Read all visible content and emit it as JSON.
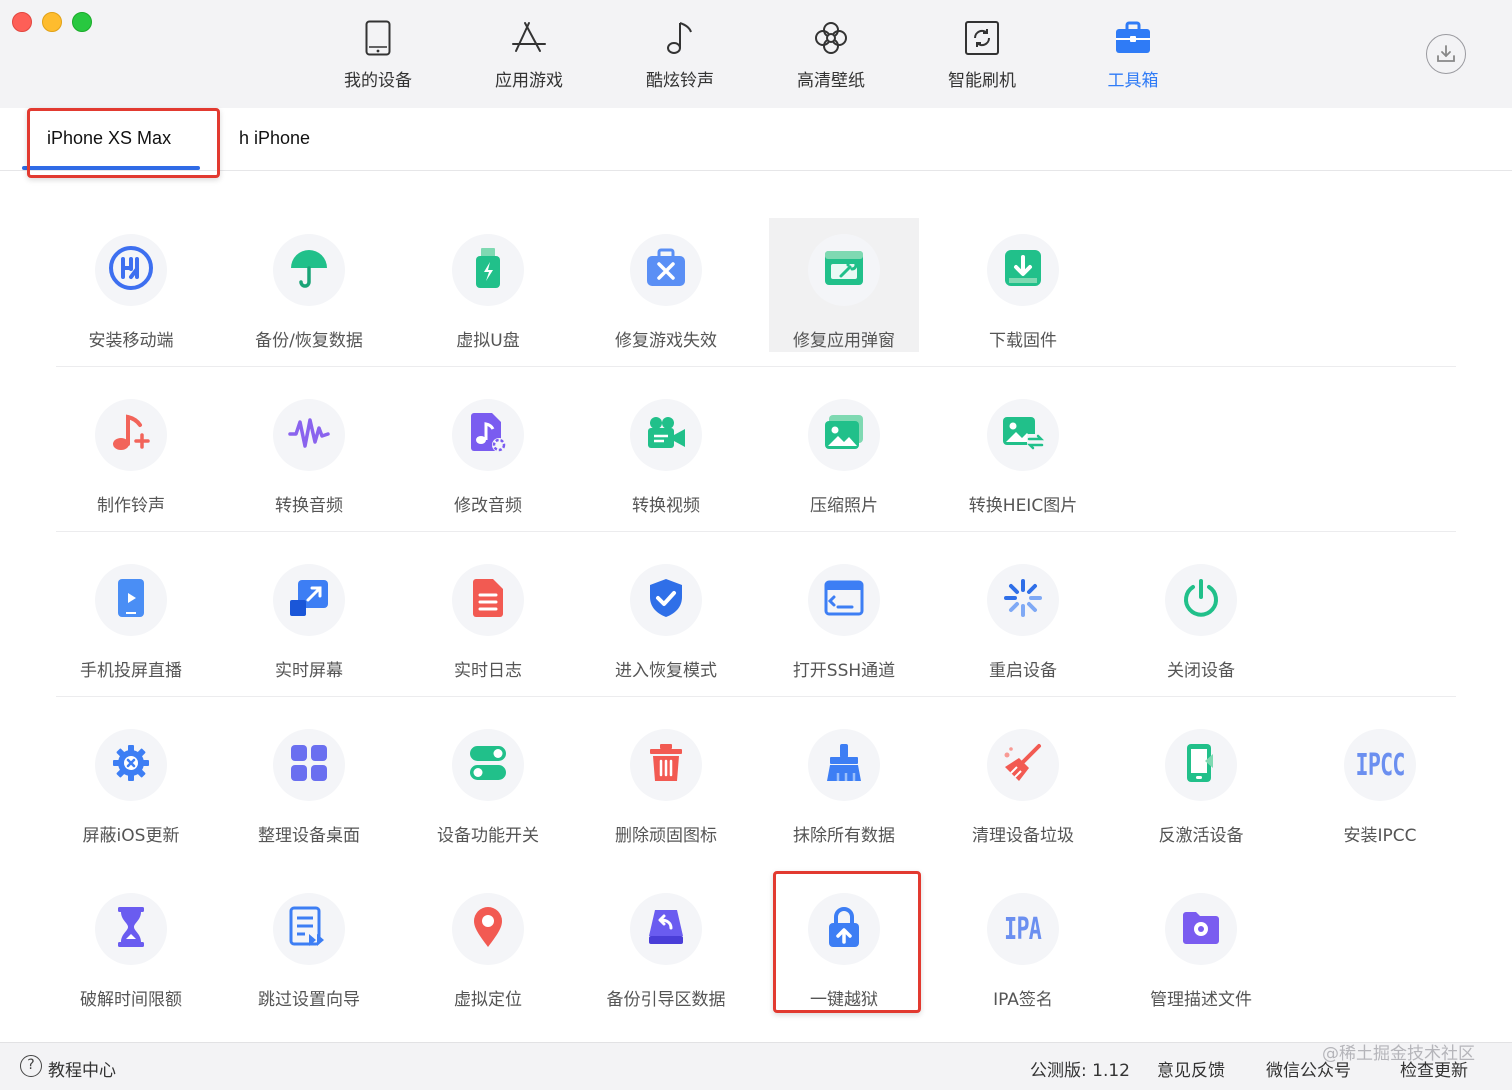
{
  "colors": {
    "accent": "#2f7bf6",
    "highlight_box": "#e23a30"
  },
  "nav": [
    {
      "label": "我的设备",
      "icon": "phone-icon"
    },
    {
      "label": "应用游戏",
      "icon": "app-store-icon"
    },
    {
      "label": "酷炫铃声",
      "icon": "music-note-icon"
    },
    {
      "label": "高清壁纸",
      "icon": "flower-icon"
    },
    {
      "label": "智能刷机",
      "icon": "refresh-icon"
    },
    {
      "label": "工具箱",
      "icon": "toolbox-icon",
      "active": true
    }
  ],
  "tabs": [
    {
      "label": "iPhone XS Max",
      "active": true
    },
    {
      "label": "h iPhone"
    }
  ],
  "tools": [
    [
      {
        "label": "安装移动端",
        "icon": "aisi-logo-icon"
      },
      {
        "label": "备份/恢复数据",
        "icon": "umbrella-icon"
      },
      {
        "label": "虚拟U盘",
        "icon": "usb-drive-icon"
      },
      {
        "label": "修复游戏失效",
        "icon": "repair-kit-icon"
      },
      {
        "label": "修复应用弹窗",
        "icon": "repair-window-icon"
      },
      {
        "label": "下载固件",
        "icon": "download-firmware-icon"
      }
    ],
    [
      {
        "label": "制作铃声",
        "icon": "ringtone-plus-icon"
      },
      {
        "label": "转换音频",
        "icon": "waveform-icon"
      },
      {
        "label": "修改音频",
        "icon": "audio-edit-icon"
      },
      {
        "label": "转换视频",
        "icon": "video-camera-icon"
      },
      {
        "label": "压缩照片",
        "icon": "photo-compress-icon"
      },
      {
        "label": "转换HEIC图片",
        "icon": "heic-convert-icon"
      }
    ],
    [
      {
        "label": "手机投屏直播",
        "icon": "screen-cast-icon"
      },
      {
        "label": "实时屏幕",
        "icon": "realtime-screen-icon"
      },
      {
        "label": "实时日志",
        "icon": "log-document-icon"
      },
      {
        "label": "进入恢复模式",
        "icon": "shield-check-icon"
      },
      {
        "label": "打开SSH通道",
        "icon": "terminal-icon"
      },
      {
        "label": "重启设备",
        "icon": "restart-spinner-icon"
      },
      {
        "label": "关闭设备",
        "icon": "power-icon"
      }
    ],
    [
      {
        "label": "屏蔽iOS更新",
        "icon": "gear-block-icon"
      },
      {
        "label": "整理设备桌面",
        "icon": "grid-apps-icon"
      },
      {
        "label": "设备功能开关",
        "icon": "toggle-switches-icon"
      },
      {
        "label": "删除顽固图标",
        "icon": "trash-icon"
      },
      {
        "label": "抹除所有数据",
        "icon": "erase-brush-icon"
      },
      {
        "label": "清理设备垃圾",
        "icon": "broom-icon"
      },
      {
        "label": "反激活设备",
        "icon": "deactivate-phone-icon"
      },
      {
        "label": "安装IPCC",
        "icon": "ipcc-text-icon",
        "text_icon": "IPCC"
      }
    ],
    [
      {
        "label": "破解时间限额",
        "icon": "hourglass-icon"
      },
      {
        "label": "跳过设置向导",
        "icon": "skip-setup-icon"
      },
      {
        "label": "虚拟定位",
        "icon": "location-pin-icon"
      },
      {
        "label": "备份引导区数据",
        "icon": "backup-boot-icon"
      },
      {
        "label": "一键越狱",
        "icon": "unlock-upload-icon"
      },
      {
        "label": "IPA签名",
        "icon": "ipa-text-icon",
        "text_icon": "IPA"
      },
      {
        "label": "管理描述文件",
        "icon": "profile-folder-icon"
      }
    ]
  ],
  "footer": {
    "help_glyph": "?",
    "help": "教程中心",
    "version": "公测版: 1.12",
    "feedback": "意见反馈",
    "wechat": "微信公众号",
    "update": "检查更新",
    "watermark": "@稀土掘金技术社区"
  }
}
